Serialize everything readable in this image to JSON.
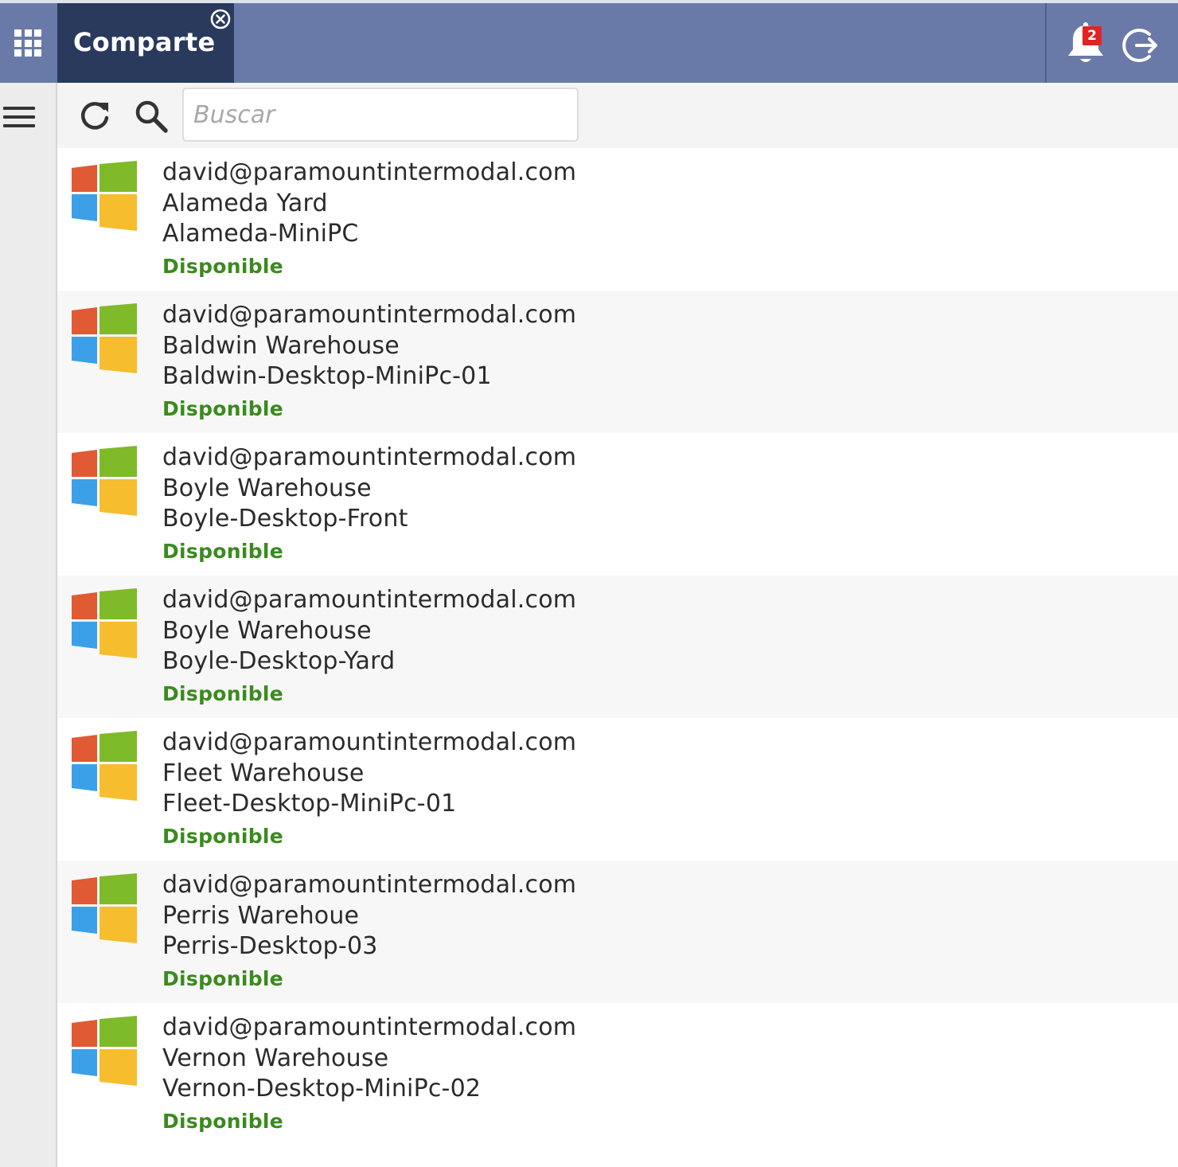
{
  "header": {
    "tab_label": "Comparte",
    "notification_count": "2"
  },
  "toolbar": {
    "search_placeholder": "Buscar"
  },
  "colors": {
    "topbar": "#6a7aa8",
    "active_tab": "#2a3a5c",
    "status_available": "#3a8a1e",
    "badge": "#e02424",
    "win_red": "#e05a33",
    "win_green": "#7fba29",
    "win_blue": "#3ca0e8",
    "win_yellow": "#f6bd2e"
  },
  "icons": {
    "apps": "grid-apps-icon",
    "close": "close-circle-icon",
    "bell": "bell-icon",
    "logout": "logout-icon",
    "menu": "hamburger-icon",
    "refresh": "refresh-icon",
    "search": "search-icon",
    "os": "windows-icon"
  },
  "devices": [
    {
      "user": "david@paramountintermodal.com",
      "location": "Alameda Yard",
      "machine": "Alameda-MiniPC",
      "status": "Disponible"
    },
    {
      "user": "david@paramountintermodal.com",
      "location": "Baldwin Warehouse",
      "machine": "Baldwin-Desktop-MiniPc-01",
      "status": "Disponible"
    },
    {
      "user": "david@paramountintermodal.com",
      "location": "Boyle Warehouse",
      "machine": "Boyle-Desktop-Front",
      "status": "Disponible"
    },
    {
      "user": "david@paramountintermodal.com",
      "location": "Boyle Warehouse",
      "machine": "Boyle-Desktop-Yard",
      "status": "Disponible"
    },
    {
      "user": "david@paramountintermodal.com",
      "location": "Fleet Warehouse",
      "machine": "Fleet-Desktop-MiniPc-01",
      "status": "Disponible"
    },
    {
      "user": "david@paramountintermodal.com",
      "location": "Perris Warehoue",
      "machine": "Perris-Desktop-03",
      "status": "Disponible"
    },
    {
      "user": "david@paramountintermodal.com",
      "location": "Vernon Warehouse",
      "machine": "Vernon-Desktop-MiniPc-02",
      "status": "Disponible"
    }
  ]
}
